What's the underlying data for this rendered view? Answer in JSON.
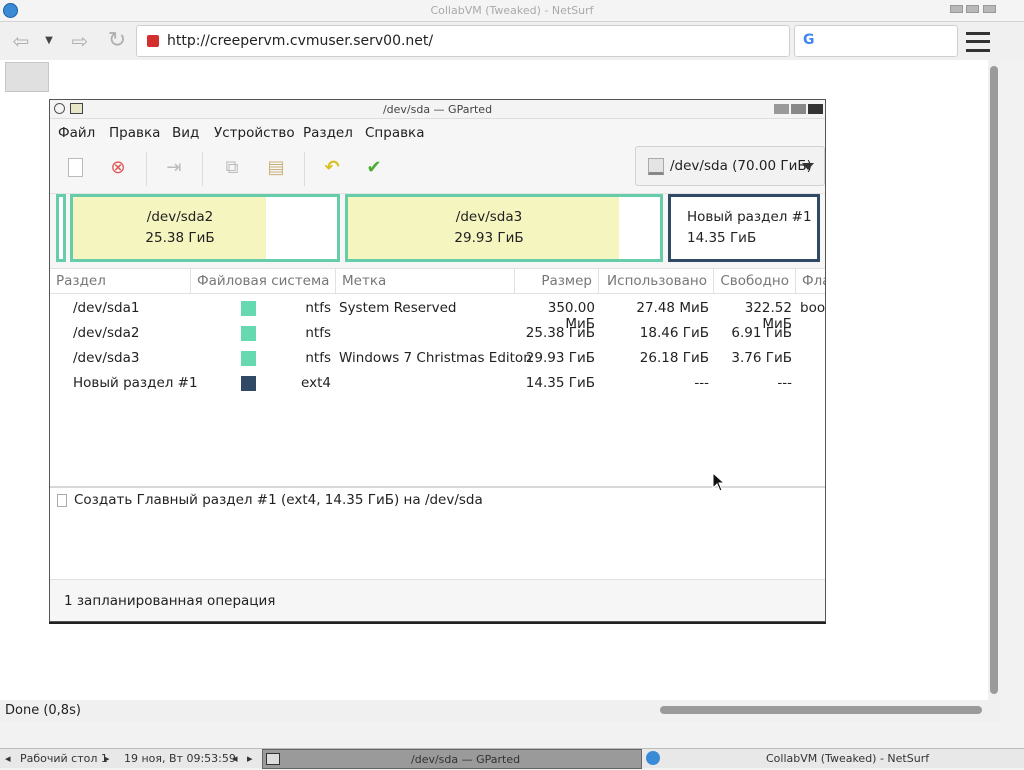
{
  "browser": {
    "window_title": "CollabVM (Tweaked) - NetSurf",
    "url": "http://creepervm.cvmuser.serv00.net/",
    "search_engine_glyph": "G",
    "status": "Done (0,8s)"
  },
  "gparted": {
    "title": "/dev/sda — GParted",
    "menu": [
      "Файл",
      "Правка",
      "Вид",
      "Устройство",
      "Раздел",
      "Справка"
    ],
    "device_selector": "/dev/sda  (70.00 ГиБ)",
    "map": [
      {
        "name": "/dev/sda2",
        "size": "25.38 ГиБ",
        "used_fraction": 0.73
      },
      {
        "name": "/dev/sda3",
        "size": "29.93 ГиБ",
        "used_fraction": 0.87
      },
      {
        "name": "Новый раздел #1",
        "size": "14.35 ГиБ",
        "used_fraction": 0
      }
    ],
    "columns": [
      "Раздел",
      "Файловая система",
      "Метка",
      "Размер",
      "Использовано",
      "Свободно",
      "Фла"
    ],
    "rows": [
      {
        "partition": "/dev/sda1",
        "fs": "ntfs",
        "label": "System Reserved",
        "size": "350.00 МиБ",
        "used": "27.48 МиБ",
        "free": "322.52 МиБ",
        "flags": "boo",
        "fs_color": "#66d9b0"
      },
      {
        "partition": "/dev/sda2",
        "fs": "ntfs",
        "label": "",
        "size": "25.38 ГиБ",
        "used": "18.46 ГиБ",
        "free": "6.91 ГиБ",
        "flags": "",
        "fs_color": "#66d9b0"
      },
      {
        "partition": "/dev/sda3",
        "fs": "ntfs",
        "label": "Windows 7 Christmas Editon",
        "size": "29.93 ГиБ",
        "used": "26.18 ГиБ",
        "free": "3.76 ГиБ",
        "flags": "",
        "fs_color": "#66d9b0"
      },
      {
        "partition": "Новый раздел #1",
        "fs": "ext4",
        "label": "",
        "size": "14.35 ГиБ",
        "used": "---",
        "free": "---",
        "flags": "",
        "fs_color": "#304a66"
      }
    ],
    "pending_operation": "Создать Главный раздел #1 (ext4, 14.35 ГиБ) на /dev/sda",
    "status": "1 запланированная операция"
  },
  "taskbar": {
    "desktop": "Рабочий стол 1",
    "clock": "19 ноя, Вт 09:53:59",
    "task1": "/dev/sda — GParted",
    "task2": "CollabVM (Tweaked) - NetSurf"
  }
}
